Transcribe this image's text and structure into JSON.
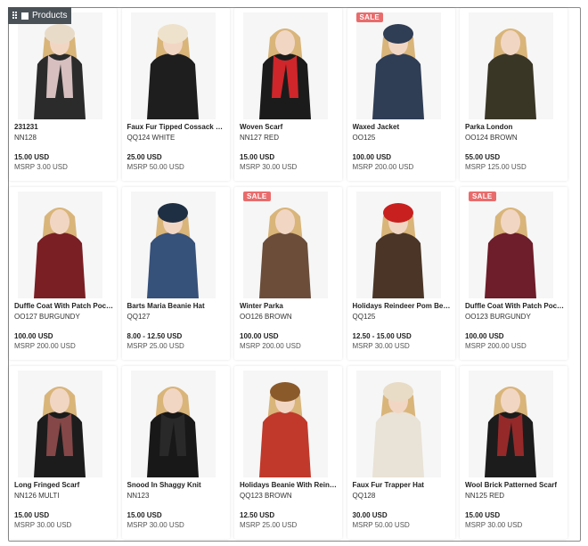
{
  "panel": {
    "title": "Products"
  },
  "products": [
    {
      "name": "231231",
      "code": "NN128",
      "price": "15.00 USD",
      "msrp": "MSRP 3.00 USD",
      "sale": false,
      "icon": "striped-sweater-scarf",
      "colors": {
        "main": "#2b2b2b",
        "accent": "#e0c7c7",
        "hat": "#e8dcc9"
      }
    },
    {
      "name": "Faux Fur Tipped Cossack Hat",
      "code": "QQ124 WHITE",
      "price": "25.00 USD",
      "msrp": "MSRP 50.00 USD",
      "sale": false,
      "icon": "fur-hat",
      "colors": {
        "main": "#1e1e1e",
        "accent": "#f0e4d2",
        "hat": "#efe2cc"
      }
    },
    {
      "name": "Woven Scarf",
      "code": "NN127 RED",
      "price": "15.00 USD",
      "msrp": "MSRP 30.00 USD",
      "sale": false,
      "icon": "red-scarf",
      "colors": {
        "main": "#1b1b1b",
        "accent": "#d8272b",
        "hat": null
      }
    },
    {
      "name": "Waxed Jacket",
      "code": "OO125",
      "price": "100.00 USD",
      "msrp": "MSRP 200.00 USD",
      "sale": true,
      "icon": "waxed-jacket",
      "colors": {
        "main": "#2f3d55",
        "accent": "#9fb3cf",
        "hat": "#2f3d55"
      }
    },
    {
      "name": "Parka London",
      "code": "OO124 BROWN",
      "price": "55.00 USD",
      "msrp": "MSRP 125.00 USD",
      "sale": false,
      "icon": "parka",
      "colors": {
        "main": "#3a3626",
        "accent": "#b9a58a",
        "hat": null
      }
    },
    {
      "name": "Duffle Coat With Patch Pockets",
      "code": "OO127 BURGUNDY",
      "price": "100.00 USD",
      "msrp": "MSRP 200.00 USD",
      "sale": false,
      "icon": "duffle-coat",
      "colors": {
        "main": "#7a1f24",
        "accent": "#5a1418",
        "hat": null
      }
    },
    {
      "name": "Barts Maria Beanie Hat",
      "code": "QQ127",
      "price": "8.00 - 12.50 USD",
      "msrp": "MSRP 25.00 USD",
      "sale": false,
      "icon": "beanie-hat",
      "colors": {
        "main": "#36517a",
        "accent": "#d84a5a",
        "hat": "#1e2f44"
      }
    },
    {
      "name": "Winter Parka",
      "code": "OO126 BROWN",
      "price": "100.00 USD",
      "msrp": "MSRP 200.00 USD",
      "sale": true,
      "icon": "winter-parka",
      "colors": {
        "main": "#6b4d3a",
        "accent": "#a8b8c8",
        "hat": null
      }
    },
    {
      "name": "Holidays Reindeer Pom Beanie",
      "code": "QQ125",
      "price": "12.50 - 15.00 USD",
      "msrp": "MSRP 30.00 USD",
      "sale": false,
      "icon": "reindeer-beanie",
      "colors": {
        "main": "#4a3526",
        "accent": "#c8201f",
        "hat": "#c8201f"
      }
    },
    {
      "name": "Duffle Coat With Patch Pockets",
      "code": "OO123 BURGUNDY",
      "price": "100.00 USD",
      "msrp": "MSRP 200.00 USD",
      "sale": true,
      "icon": "burgundy-parka",
      "colors": {
        "main": "#6e1d2a",
        "accent": "#c9b49a",
        "hat": null
      }
    },
    {
      "name": "Long Fringed Scarf",
      "code": "NN126 MULTI",
      "price": "15.00 USD",
      "msrp": "MSRP 30.00 USD",
      "sale": false,
      "icon": "fringed-scarf",
      "colors": {
        "main": "#1c1c1c",
        "accent": "#8b4a4a",
        "hat": null
      }
    },
    {
      "name": "Snood In Shaggy Knit",
      "code": "NN123",
      "price": "15.00 USD",
      "msrp": "MSRP 30.00 USD",
      "sale": false,
      "icon": "shaggy-snood",
      "colors": {
        "main": "#181818",
        "accent": "#2a2a2a",
        "hat": null
      }
    },
    {
      "name": "Holidays Beanie With Reindeer Ears",
      "code": "QQ123 BROWN",
      "price": "12.50 USD",
      "msrp": "MSRP 25.00 USD",
      "sale": false,
      "icon": "antler-beanie",
      "colors": {
        "main": "#c0392b",
        "accent": "#ffffff",
        "hat": "#8b5a2b"
      }
    },
    {
      "name": "Faux Fur Trapper Hat",
      "code": "QQ128",
      "price": "30.00 USD",
      "msrp": "MSRP 50.00 USD",
      "sale": false,
      "icon": "trapper-hat",
      "colors": {
        "main": "#e9e2d6",
        "accent": "#c9b9a2",
        "hat": "#e8dcc6"
      }
    },
    {
      "name": "Wool Brick Patterned Scarf",
      "code": "NN125 RED",
      "price": "15.00 USD",
      "msrp": "MSRP 30.00 USD",
      "sale": false,
      "icon": "brick-scarf",
      "colors": {
        "main": "#1c1c1c",
        "accent": "#9c2a2a",
        "hat": null
      }
    }
  ],
  "sale_label": "SALE"
}
